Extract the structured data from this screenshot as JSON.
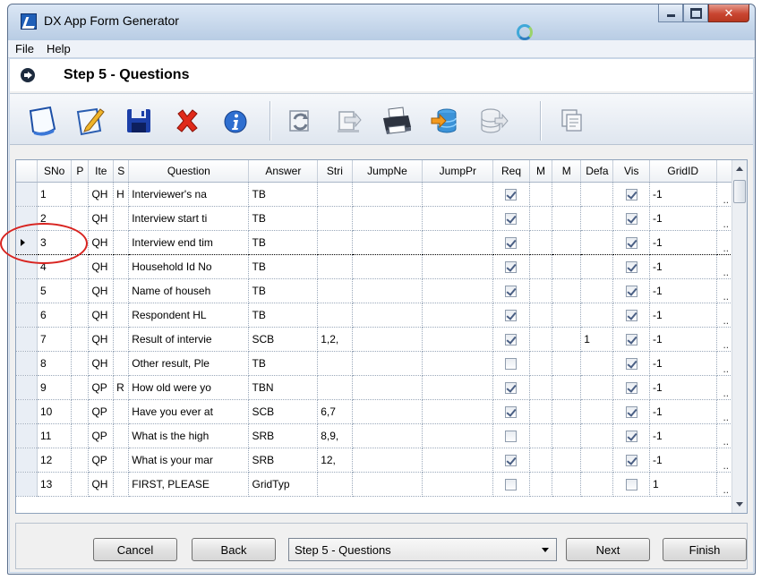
{
  "window": {
    "title": "DX App Form Generator"
  },
  "menu": [
    "File",
    "Help"
  ],
  "step": {
    "title": "Step 5 - Questions"
  },
  "toolbar": [
    {
      "icon": "new-document-icon"
    },
    {
      "icon": "edit-icon"
    },
    {
      "icon": "save-icon"
    },
    {
      "icon": "delete-icon"
    },
    {
      "icon": "info-icon"
    },
    {
      "icon": "refresh-icon"
    },
    {
      "icon": "import-icon"
    },
    {
      "icon": "print-icon"
    },
    {
      "icon": "database-export-icon"
    },
    {
      "icon": "database-import-icon"
    },
    {
      "icon": "copy-icon"
    }
  ],
  "grid": {
    "columns": [
      "SNo",
      "P",
      "Ite",
      "S",
      "Question",
      "Answer",
      "Stri",
      "JumpNe",
      "JumpPr",
      "Req",
      "M",
      "M",
      "Defa",
      "Vis",
      "GridID",
      ""
    ],
    "current_row_index": 2,
    "rows": [
      {
        "sno": "1",
        "p": "",
        "item": "QH",
        "s": "H",
        "question": "Interviewer's na",
        "answer": "TB",
        "stri": "",
        "jumpne": "",
        "jumppr": "",
        "req": true,
        "m1": "",
        "m2": "",
        "defa": "",
        "vis": true,
        "gridid": "-1",
        "more": ".."
      },
      {
        "sno": "2",
        "p": "",
        "item": "QH",
        "s": "",
        "question": "Interview start ti",
        "answer": "TB",
        "stri": "",
        "jumpne": "",
        "jumppr": "",
        "req": true,
        "m1": "",
        "m2": "",
        "defa": "",
        "vis": true,
        "gridid": "-1",
        "more": ".."
      },
      {
        "sno": "3",
        "p": "",
        "item": "QH",
        "s": "",
        "question": "Interview end tim",
        "answer": "TB",
        "stri": "",
        "jumpne": "",
        "jumppr": "",
        "req": true,
        "m1": "",
        "m2": "",
        "defa": "",
        "vis": true,
        "gridid": "-1",
        "more": ".."
      },
      {
        "sno": "4",
        "p": "",
        "item": "QH",
        "s": "",
        "question": "Household Id No",
        "answer": "TB",
        "stri": "",
        "jumpne": "",
        "jumppr": "",
        "req": true,
        "m1": "",
        "m2": "",
        "defa": "",
        "vis": true,
        "gridid": "-1",
        "more": ".."
      },
      {
        "sno": "5",
        "p": "",
        "item": "QH",
        "s": "",
        "question": "Name of househ",
        "answer": "TB",
        "stri": "",
        "jumpne": "",
        "jumppr": "",
        "req": true,
        "m1": "",
        "m2": "",
        "defa": "",
        "vis": true,
        "gridid": "-1",
        "more": ".."
      },
      {
        "sno": "6",
        "p": "",
        "item": "QH",
        "s": "",
        "question": "Respondent HL",
        "answer": "TB",
        "stri": "",
        "jumpne": "",
        "jumppr": "",
        "req": true,
        "m1": "",
        "m2": "",
        "defa": "",
        "vis": true,
        "gridid": "-1",
        "more": ".."
      },
      {
        "sno": "7",
        "p": "",
        "item": "QH",
        "s": "",
        "question": "Result of intervie",
        "answer": "SCB",
        "stri": "1,2,",
        "jumpne": "",
        "jumppr": "",
        "req": true,
        "m1": "",
        "m2": "",
        "defa": "1",
        "vis": true,
        "gridid": "-1",
        "more": ".."
      },
      {
        "sno": "8",
        "p": "",
        "item": "QH",
        "s": "",
        "question": "Other result, Ple",
        "answer": "TB",
        "stri": "",
        "jumpne": "",
        "jumppr": "",
        "req": false,
        "m1": "",
        "m2": "",
        "defa": "",
        "vis": true,
        "gridid": "-1",
        "more": ".."
      },
      {
        "sno": "9",
        "p": "",
        "item": "QP",
        "s": "R",
        "question": "How old were yo",
        "answer": "TBN",
        "stri": "",
        "jumpne": "",
        "jumppr": "",
        "req": true,
        "m1": "",
        "m2": "",
        "defa": "",
        "vis": true,
        "gridid": "-1",
        "more": ".."
      },
      {
        "sno": "10",
        "p": "",
        "item": "QP",
        "s": "",
        "question": "Have you ever at",
        "answer": "SCB",
        "stri": "6,7",
        "jumpne": "",
        "jumppr": "",
        "req": true,
        "m1": "",
        "m2": "",
        "defa": "",
        "vis": true,
        "gridid": "-1",
        "more": ".."
      },
      {
        "sno": "11",
        "p": "",
        "item": "QP",
        "s": "",
        "question": "What is the high",
        "answer": "SRB",
        "stri": "8,9,",
        "jumpne": "",
        "jumppr": "",
        "req": false,
        "m1": "",
        "m2": "",
        "defa": "",
        "vis": true,
        "gridid": "-1",
        "more": ".."
      },
      {
        "sno": "12",
        "p": "",
        "item": "QP",
        "s": "",
        "question": "What is your mar",
        "answer": "SRB",
        "stri": "12,",
        "jumpne": "",
        "jumppr": "",
        "req": true,
        "m1": "",
        "m2": "",
        "defa": "",
        "vis": true,
        "gridid": "-1",
        "more": ".."
      },
      {
        "sno": "13",
        "p": "",
        "item": "QH",
        "s": "",
        "question": "FIRST, PLEASE",
        "answer": "GridTyp",
        "stri": "",
        "jumpne": "",
        "jumppr": "",
        "req": false,
        "m1": "",
        "m2": "",
        "defa": "",
        "vis": false,
        "gridid": "1",
        "more": ".."
      }
    ]
  },
  "footer": {
    "cancel": "Cancel",
    "back": "Back",
    "step_select": "Step 5 - Questions",
    "next": "Next",
    "finish": "Finish"
  },
  "colors": {
    "highlight": "#d8231f",
    "accent": "#1f5fb8"
  }
}
